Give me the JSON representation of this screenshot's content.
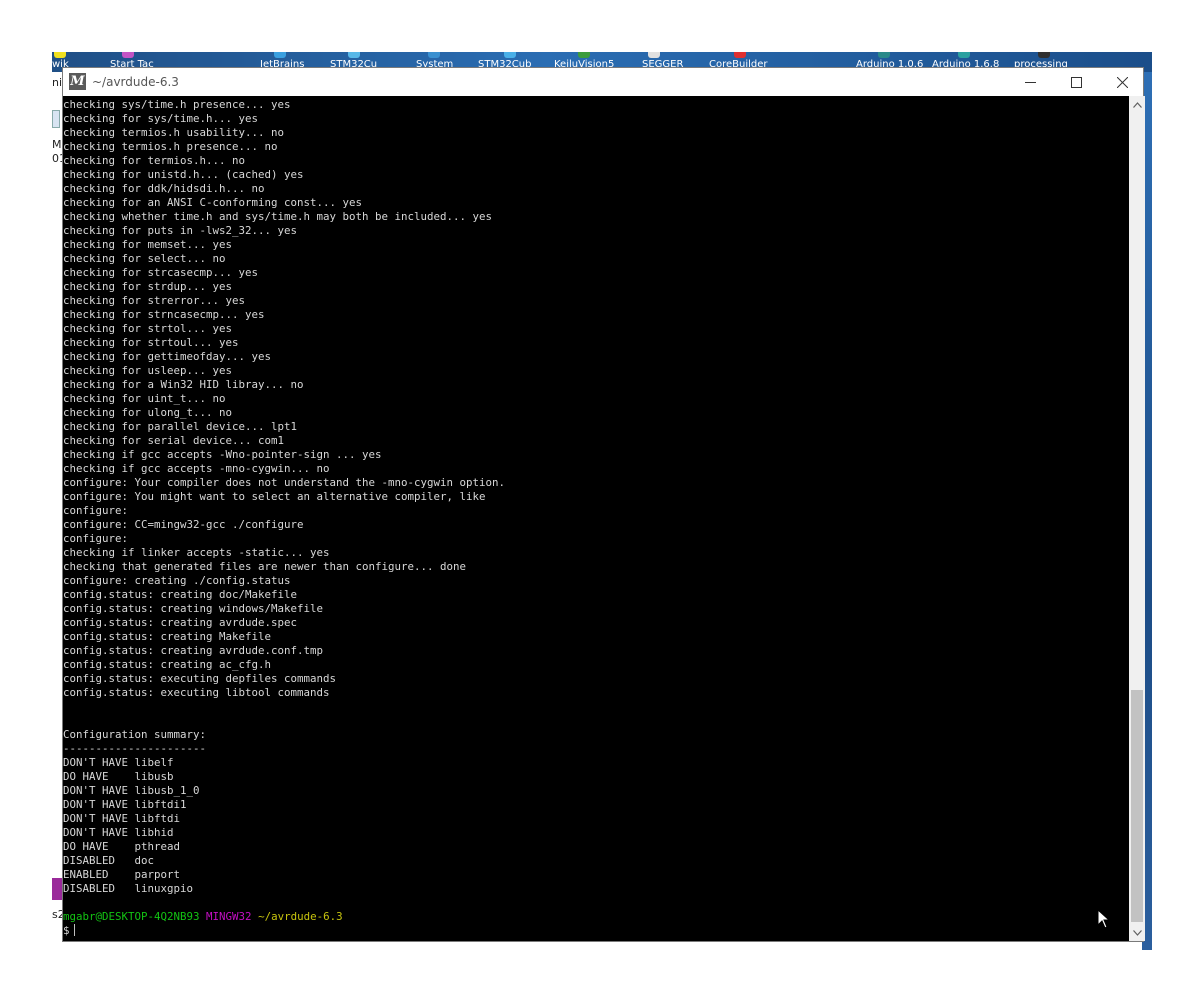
{
  "desktop": {
    "icon_labels": [
      "wik",
      "Start Tac",
      "JetBrains",
      "STM32Cu",
      "System",
      "STM32Cub",
      "KeiluVision5",
      "SEGGER",
      "CoreBuilder",
      "Arduino 1.0.6",
      "Arduino 1.6.8",
      "processing"
    ],
    "left_fragments": [
      "ni",
      "M",
      "01",
      "s2"
    ]
  },
  "window": {
    "title": "~/avrdude-6.3",
    "icon_glyph": "M",
    "icons": {
      "minimize": "minimize-icon",
      "maximize": "maximize-icon",
      "close": "close-icon"
    }
  },
  "terminal": {
    "lines": [
      "checking sys/time.h presence... yes",
      "checking for sys/time.h... yes",
      "checking termios.h usability... no",
      "checking termios.h presence... no",
      "checking for termios.h... no",
      "checking for unistd.h... (cached) yes",
      "checking for ddk/hidsdi.h... no",
      "checking for an ANSI C-conforming const... yes",
      "checking whether time.h and sys/time.h may both be included... yes",
      "checking for puts in -lws2_32... yes",
      "checking for memset... yes",
      "checking for select... no",
      "checking for strcasecmp... yes",
      "checking for strdup... yes",
      "checking for strerror... yes",
      "checking for strncasecmp... yes",
      "checking for strtol... yes",
      "checking for strtoul... yes",
      "checking for gettimeofday... yes",
      "checking for usleep... yes",
      "checking for a Win32 HID libray... no",
      "checking for uint_t... no",
      "checking for ulong_t... no",
      "checking for parallel device... lpt1",
      "checking for serial device... com1",
      "checking if gcc accepts -Wno-pointer-sign ... yes",
      "checking if gcc accepts -mno-cygwin... no",
      "configure: Your compiler does not understand the -mno-cygwin option.",
      "configure: You might want to select an alternative compiler, like",
      "configure:",
      "configure: CC=mingw32-gcc ./configure",
      "configure:",
      "checking if linker accepts -static... yes",
      "checking that generated files are newer than configure... done",
      "configure: creating ./config.status",
      "config.status: creating doc/Makefile",
      "config.status: creating windows/Makefile",
      "config.status: creating avrdude.spec",
      "config.status: creating Makefile",
      "config.status: creating avrdude.conf.tmp",
      "config.status: creating ac_cfg.h",
      "config.status: executing depfiles commands",
      "config.status: executing libtool commands",
      "",
      "",
      "Configuration summary:",
      "----------------------",
      "DON'T HAVE libelf",
      "DO HAVE    libusb",
      "DON'T HAVE libusb_1_0",
      "DON'T HAVE libftdi1",
      "DON'T HAVE libftdi",
      "DON'T HAVE libhid",
      "DO HAVE    pthread",
      "DISABLED   doc",
      "ENABLED    parport",
      "DISABLED   linuxgpio",
      ""
    ],
    "prompt": {
      "user_host": "mgabr@DESKTOP-4Q2NB93",
      "system": "MINGW32",
      "path": "~/avrdude-6.3",
      "symbol": "$"
    },
    "colors": {
      "text": "#d8d8d8",
      "user_host": "#13c413",
      "system": "#c40fc4",
      "path": "#c7c40e",
      "background": "#000000"
    }
  },
  "scrollbar": {
    "up_icon": "chevron-up-icon",
    "down_icon": "chevron-down-icon"
  }
}
